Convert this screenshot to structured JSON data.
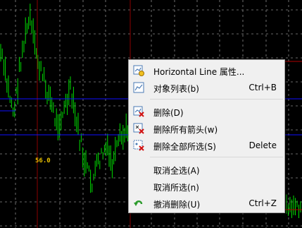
{
  "chart": {
    "price_label": "56.0",
    "colors": {
      "background": "#000000",
      "grid": "#8a8a8a",
      "candles": "#00dd00",
      "hline": "#1010ff",
      "vline": "#8b0000"
    }
  },
  "context_menu": {
    "items": [
      {
        "icon": "line-properties-icon",
        "label": "Horizontal Line 属性...",
        "shortcut": ""
      },
      {
        "icon": "object-list-icon",
        "label": "对象列表(b)",
        "shortcut": "Ctrl+B"
      },
      {
        "icon": "delete-icon",
        "label": "删除(D)",
        "shortcut": ""
      },
      {
        "icon": "delete-arrows-icon",
        "label": "删除所有箭头(w)",
        "shortcut": ""
      },
      {
        "icon": "delete-selected-icon",
        "label": "删除全部所选(S)",
        "shortcut": "Delete"
      },
      {
        "icon": "",
        "label": "取消全选(A)",
        "shortcut": ""
      },
      {
        "icon": "",
        "label": "取消所选(n)",
        "shortcut": ""
      },
      {
        "icon": "undo-icon",
        "label": "撤消删除(U)",
        "shortcut": "Ctrl+Z"
      }
    ]
  }
}
